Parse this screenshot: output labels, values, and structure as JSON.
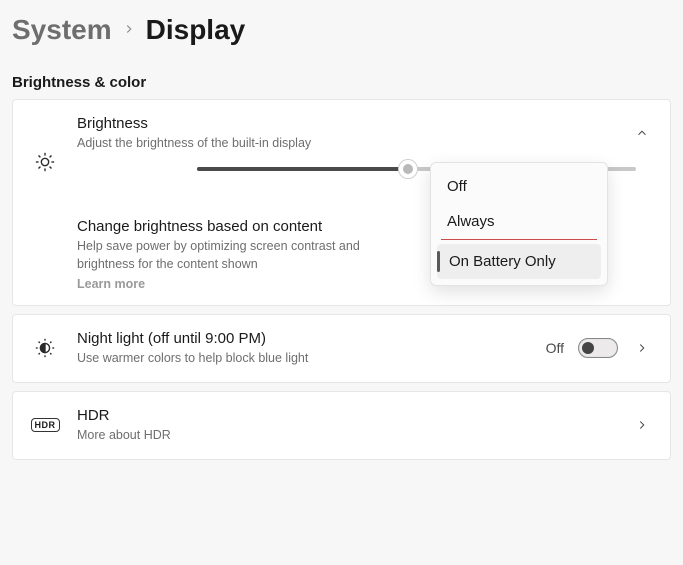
{
  "breadcrumb": {
    "parent": "System",
    "current": "Display"
  },
  "section_title": "Brightness & color",
  "brightness": {
    "title": "Brightness",
    "desc": "Adjust the brightness of the built-in display",
    "slider_percent": 48,
    "dropdown": {
      "options": [
        "Off",
        "Always",
        "On Battery Only"
      ],
      "selected_index": 2
    }
  },
  "adaptive": {
    "title": "Change brightness based on content",
    "desc": "Help save power by optimizing screen contrast and brightness for the content shown",
    "learn_more": "Learn more"
  },
  "night_light": {
    "title": "Night light (off until 9:00 PM)",
    "desc": "Use warmer colors to help block blue light",
    "state_label": "Off",
    "enabled": false
  },
  "hdr": {
    "title": "HDR",
    "desc": "More about HDR",
    "badge": "HDR"
  }
}
